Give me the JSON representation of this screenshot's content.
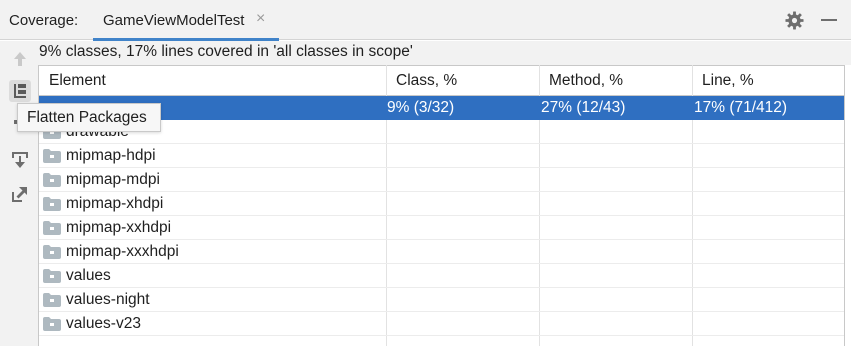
{
  "header": {
    "label": "Coverage:",
    "tab_title": "GameViewModelTest",
    "tab_close": "×"
  },
  "summary": "9% classes, 17% lines covered in 'all classes in scope'",
  "tooltip": "Flatten Packages",
  "table": {
    "columns": [
      "Element",
      "Class, %",
      "Method, %",
      "Line, %"
    ],
    "selected_row": {
      "class": "9% (3/32)",
      "method": "27% (12/43)",
      "line": "17% (71/412)"
    },
    "rows": [
      "drawable",
      "mipmap-hdpi",
      "mipmap-mdpi",
      "mipmap-xhdpi",
      "mipmap-xxhdpi",
      "mipmap-xxxhdpi",
      "values",
      "values-night",
      "values-v23"
    ]
  },
  "icons": {
    "toolbar": [
      "arrow-up-icon",
      "flatten-packages-icon",
      "filter-icon",
      "import-icon",
      "export-icon"
    ],
    "header": [
      "gear-icon",
      "minimize-icon"
    ],
    "row": "folder-icon"
  },
  "colors": {
    "selection": "#2f6fc1",
    "tab_underline": "#4083c9",
    "panel_bg": "#f2f2f2"
  }
}
